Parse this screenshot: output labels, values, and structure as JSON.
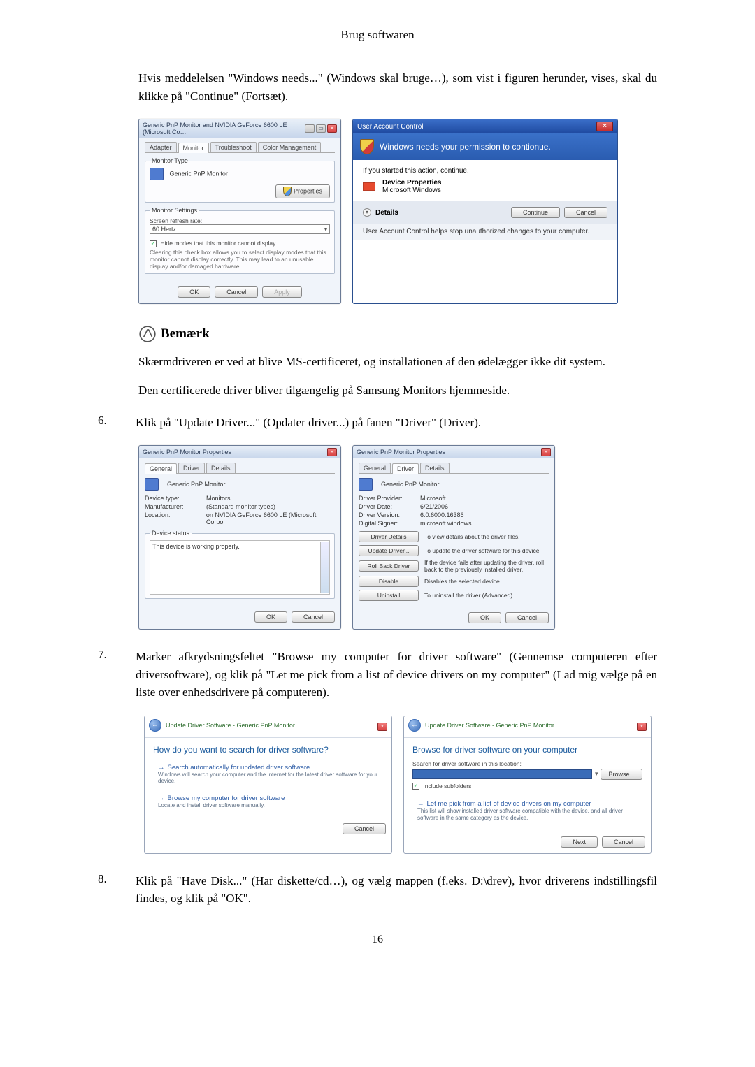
{
  "header": {
    "title": "Brug softwaren"
  },
  "intro": {
    "text": "Hvis meddelelsen \"Windows needs...\" (Windows skal bruge…), som vist i figuren herunder, vises, skal du klikke på \"Continue\" (Fortsæt)."
  },
  "fig1": {
    "monitor_dialog": {
      "title": "Generic PnP Monitor and NVIDIA GeForce 6600 LE (Microsoft Co…",
      "tabs": [
        "Adapter",
        "Monitor",
        "Troubleshoot",
        "Color Management"
      ],
      "active_tab": 1,
      "monitor_type_legend": "Monitor Type",
      "monitor_name": "Generic PnP Monitor",
      "properties_btn": "Properties",
      "monitor_settings_legend": "Monitor Settings",
      "refresh_label": "Screen refresh rate:",
      "refresh_value": "60 Hertz",
      "hide_modes_checked": true,
      "hide_modes_label": "Hide modes that this monitor cannot display",
      "hide_modes_help": "Clearing this check box allows you to select display modes that this monitor cannot display correctly. This may lead to an unusable display and/or damaged hardware.",
      "ok": "OK",
      "cancel": "Cancel",
      "apply": "Apply"
    },
    "uac": {
      "title": "User Account Control",
      "banner": "Windows needs your permission to contionue.",
      "if_started": "If you started this action, continue.",
      "item_name": "Device Properties",
      "item_pub": "Microsoft Windows",
      "details": "Details",
      "continue": "Continue",
      "cancel": "Cancel",
      "footer": "User Account Control helps stop unauthorized changes to your computer."
    }
  },
  "note": {
    "label": "Bemærk",
    "line1": "Skærmdriveren er ved at blive MS-certificeret, og installationen af den ødelægger ikke dit system.",
    "line2": "Den certificerede driver bliver tilgængelig på Samsung Monitors hjemmeside."
  },
  "steps": {
    "six": {
      "num": "6.",
      "text": "Klik på \"Update Driver...\" (Opdater driver...) på fanen \"Driver\" (Driver)."
    },
    "seven": {
      "num": "7.",
      "text": "Marker afkrydsningsfeltet \"Browse my computer for driver software\" (Gennemse computeren efter driversoftware), og klik på \"Let me pick from a list of device drivers on my computer\" (Lad mig vælge på en liste over enhedsdrivere på computeren)."
    },
    "eight": {
      "num": "8.",
      "text": "Klik på \"Have Disk...\" (Har diskette/cd…), og vælg mappen (f.eks. D:\\drev), hvor driverens indstillingsfil findes, og klik på \"OK\"."
    }
  },
  "fig2": {
    "left": {
      "title": "Generic PnP Monitor Properties",
      "tabs": [
        "General",
        "Driver",
        "Details"
      ],
      "active_tab": 0,
      "name": "Generic PnP Monitor",
      "rows": [
        {
          "k": "Device type:",
          "v": "Monitors"
        },
        {
          "k": "Manufacturer:",
          "v": "(Standard monitor types)"
        },
        {
          "k": "Location:",
          "v": "on NVIDIA GeForce 6600 LE (Microsoft Corpo"
        }
      ],
      "status_legend": "Device status",
      "status_text": "This device is working properly.",
      "ok": "OK",
      "cancel": "Cancel"
    },
    "right": {
      "title": "Generic PnP Monitor Properties",
      "tabs": [
        "General",
        "Driver",
        "Details"
      ],
      "active_tab": 1,
      "name": "Generic PnP Monitor",
      "rows": [
        {
          "k": "Driver Provider:",
          "v": "Microsoft"
        },
        {
          "k": "Driver Date:",
          "v": "6/21/2006"
        },
        {
          "k": "Driver Version:",
          "v": "6.0.6000.16386"
        },
        {
          "k": "Digital Signer:",
          "v": "microsoft windows"
        }
      ],
      "actions": [
        {
          "btn": "Driver Details",
          "desc": "To view details about the driver files."
        },
        {
          "btn": "Update Driver...",
          "desc": "To update the driver software for this device."
        },
        {
          "btn": "Roll Back Driver",
          "desc": "If the device fails after updating the driver, roll back to the previously installed driver."
        },
        {
          "btn": "Disable",
          "desc": "Disables the selected device."
        },
        {
          "btn": "Uninstall",
          "desc": "To uninstall the driver (Advanced)."
        }
      ],
      "ok": "OK",
      "cancel": "Cancel"
    }
  },
  "fig3": {
    "left": {
      "crumb": "Update Driver Software - Generic PnP Monitor",
      "heading": "How do you want to search for driver software?",
      "opt1_title": "Search automatically for updated driver software",
      "opt1_sub": "Windows will search your computer and the Internet for the latest driver software for your device.",
      "opt2_title": "Browse my computer for driver software",
      "opt2_sub": "Locate and install driver software manually.",
      "cancel": "Cancel"
    },
    "right": {
      "crumb": "Update Driver Software - Generic PnP Monitor",
      "heading": "Browse for driver software on your computer",
      "search_label": "Search for driver software in this location:",
      "browse": "Browse...",
      "include_sub": "Include subfolders",
      "pick_title": "Let me pick from a list of device drivers on my computer",
      "pick_sub": "This list will show installed driver software compatible with the device, and all driver software in the same category as the device.",
      "next": "Next",
      "cancel": "Cancel"
    }
  },
  "page_number": "16"
}
